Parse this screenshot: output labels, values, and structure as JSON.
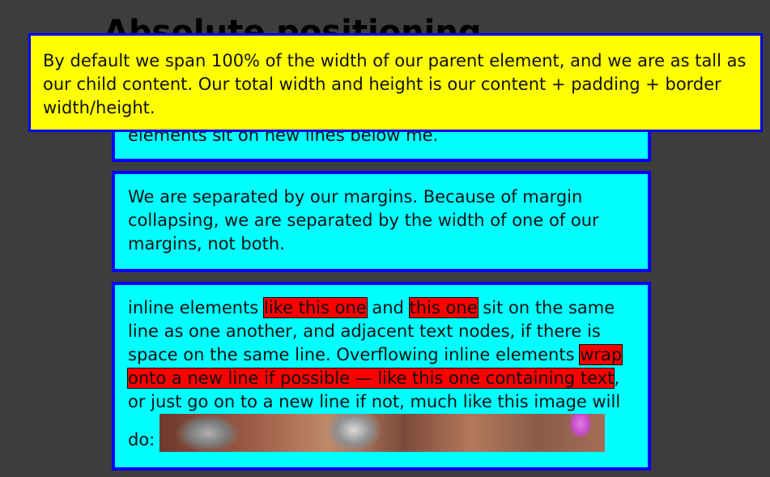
{
  "heading": "Absolute positioning",
  "boxes": {
    "box1": "elements sit on new lines below me.",
    "box2": "We are separated by our margins. Because of margin collapsing, we are separated by the width of one of our margins, not both.",
    "box3": {
      "t1": "inline elements ",
      "h1": "like this one",
      "t2": " and ",
      "h2": "this one",
      "t3": " sit on the same line as one another, and adjacent text nodes, if there is space on the same line. Overflowing inline elements ",
      "h3": "wrap onto a new line if possible — like this one containing text",
      "t4": ", or just go on to a new line if not, much like this image will do:"
    }
  },
  "overlay": {
    "text": "By default we span 100% of the width of our parent element, and we are as tall as our child content. Our total width and height is our content + padding + border width/height."
  },
  "colors": {
    "page_background": "#3d3d3d",
    "block_background": "#00ffff",
    "block_border": "#0000ff",
    "inline_highlight": "#ff0000",
    "overlay_background": "#ffff00"
  }
}
